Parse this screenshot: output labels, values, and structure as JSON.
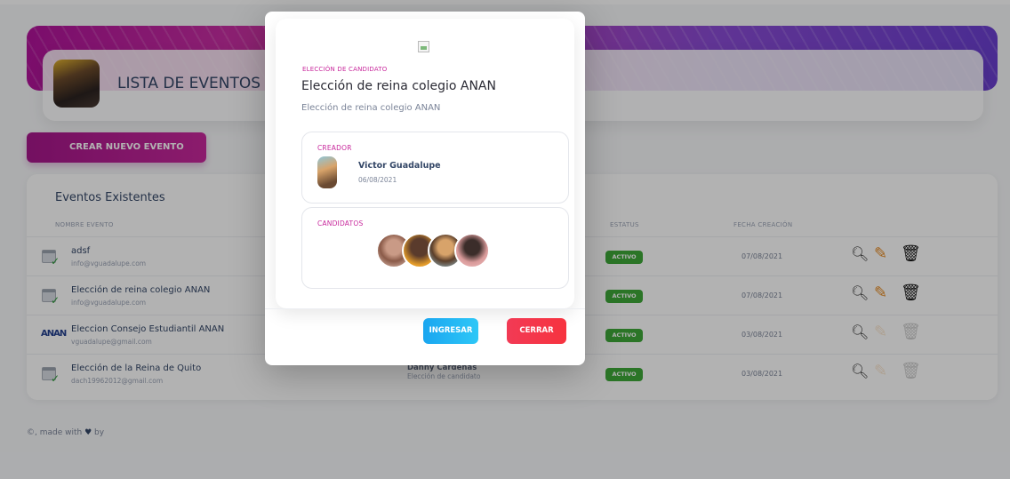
{
  "header": {
    "page_title": "LISTA DE EVENTOS EXISTENTES",
    "create_button": "CREAR NUEVO EVENTO"
  },
  "table": {
    "title": "Eventos Existentes",
    "columns": [
      "NOMBRE EVENTO",
      "ESTATUS",
      "FECHA CREACIÓN"
    ],
    "rows": [
      {
        "name": "adsf",
        "email": "info@vguadalupe.com",
        "creator": "",
        "type": "",
        "status": "ACTIVO",
        "date": "07/08/2021",
        "icon": "calendar-check-icon",
        "editable": true
      },
      {
        "name": "Elección de reina colegio ANAN",
        "email": "info@vguadalupe.com",
        "creator": "",
        "type": "",
        "status": "ACTIVO",
        "date": "07/08/2021",
        "icon": "calendar-check-icon",
        "editable": true
      },
      {
        "name": "Eleccion Consejo Estudiantil ANAN",
        "email": "vguadalupe@gmail.com",
        "creator": "",
        "type": "",
        "status": "ACTIVO",
        "date": "03/08/2021",
        "icon": "anan-logo-icon",
        "editable": false
      },
      {
        "name": "Elección de la Reina de Quito",
        "email": "dach19962012@gmail.com",
        "creator": "Danny Cárdenas",
        "type": "Elección de candidato",
        "status": "ACTIVO",
        "date": "03/08/2021",
        "icon": "calendar-check-icon",
        "editable": false
      }
    ]
  },
  "footer": {
    "prefix": "©, made with",
    "suffix": "by"
  },
  "modal": {
    "type_label": "ELECCIÓN DE CANDIDATO",
    "title": "Elección de reina colegio ANAN",
    "description": "Elección de reina colegio ANAN",
    "creator_label": "CREADOR",
    "creator_name": "Victor Guadalupe",
    "creator_date": "06/08/2021",
    "candidates_label": "CANDIDATOS",
    "enter_button": "INGRESAR",
    "close_button": "CERRAR"
  },
  "colors": {
    "accent": "#c8289c",
    "status_active": "#3ea839",
    "enter": "#1aa6f0",
    "close": "#f23a55"
  }
}
